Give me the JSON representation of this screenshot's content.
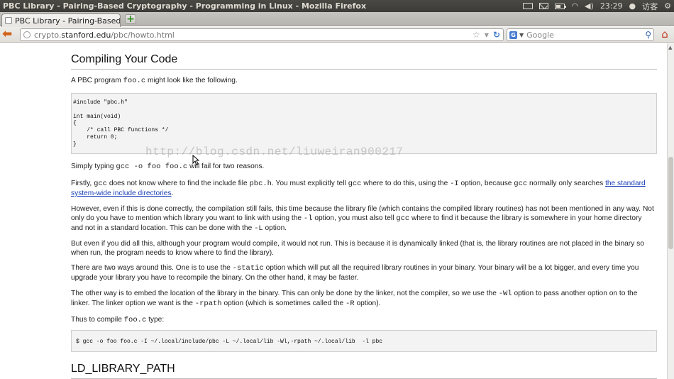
{
  "window": {
    "title": "PBC Library - Pairing-Based Cryptography - Programming in Linux - Mozilla Firefox",
    "clock": "23:29",
    "user": "访客"
  },
  "tabs": [
    {
      "label": "PBC Library - Pairing-Based Cr..."
    }
  ],
  "nav": {
    "url_prefix": "crypto.",
    "url_host": "stanford.edu",
    "url_path": "/pbc/howto.html",
    "search_placeholder": "Google"
  },
  "page": {
    "heading1": "Compiling Your Code",
    "p_intro_a": "A PBC program ",
    "p_intro_code": "foo.c",
    "p_intro_b": " might look like the following.",
    "code1": "#include \"pbc.h\"\n\nint main(void)\n{\n    /* call PBC functions */\n    return 0;\n}",
    "p_typing_a": "Simply typing ",
    "p_typing_code": "gcc -o foo foo.c",
    "p_typing_b": " will fail for two reasons.",
    "p_first_1": "Firstly, ",
    "p_first_c1": "gcc",
    "p_first_2": " does not know where to find the include file ",
    "p_first_c2": "pbc.h",
    "p_first_3": ". You must explicitly tell ",
    "p_first_c3": "gcc",
    "p_first_4": " where to do this, using the ",
    "p_first_c4": "-I",
    "p_first_5": " option, because ",
    "p_first_c5": "gcc",
    "p_first_6": " normally only searches ",
    "p_first_link": "the standard system-wide include directories",
    "p_first_7": ".",
    "p_however_1": "However, even if this is done correctly, the compilation still fails, this time because the library file (which contains the compiled library routines) has not been mentioned in any way. Not only do you have to mention which library you want to link with using the ",
    "p_however_c1": "-l",
    "p_however_2": " option, you must also tell ",
    "p_however_c2": "gcc",
    "p_however_3": " where to find it because the library is somewhere in your home directory and not in a standard location. This can be done with the ",
    "p_however_c3": "-L",
    "p_however_4": " option.",
    "p_buteven": "But even if you did all this, although your program would compile, it would not run. This is because it is dynamically linked (that is, the library routines are not placed in the binary so when run, the program needs to know where to find the library).",
    "p_two_1": "There are two ways around this. One is to use the ",
    "p_two_c1": "-static",
    "p_two_2": " option which will put all the required library routines in your binary. Your binary will be a lot bigger, and every time you upgrade your library you have to recompile the binary. On the other hand, it may be faster.",
    "p_other_1": "The other way is to embed the location of the library in the binary. This can only be done by the linker, not the compiler, so we use the ",
    "p_other_c1": "-Wl",
    "p_other_2": " option to pass another option on to the linker. The linker option we want is the ",
    "p_other_c2": "-rpath",
    "p_other_3": " option (which is sometimes called the ",
    "p_other_c3": "-R",
    "p_other_4": " option).",
    "p_thus_a": "Thus to compile ",
    "p_thus_code": "foo.c",
    "p_thus_b": " type:",
    "code2": "$ gcc -o foo foo.c -I ~/.local/include/pbc -L ~/.local/lib -Wl,-rpath ~/.local/lib  -l pbc",
    "heading2": "LD_LIBRARY_PATH",
    "watermark": "http://blog.csdn.net/liuweiran900217"
  }
}
